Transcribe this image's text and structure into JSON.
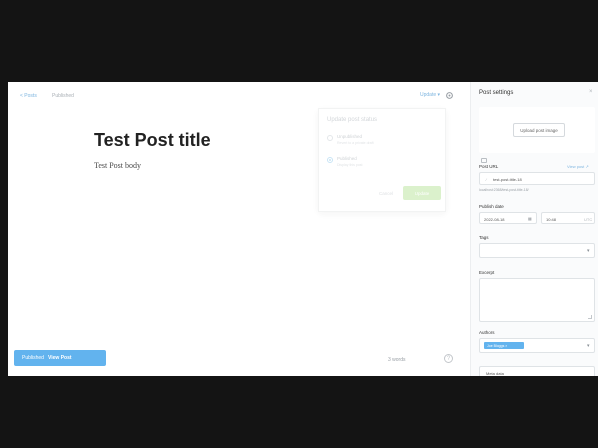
{
  "header": {
    "back_label": "< Posts",
    "status_label": "Published",
    "update_label": "Update ▾"
  },
  "post": {
    "title": "Test Post title",
    "body": "Test Post body"
  },
  "publish_menu": {
    "title": "Update post status",
    "options": [
      {
        "label": "Unpublished",
        "desc": "Revert to a private draft"
      },
      {
        "label": "Published",
        "desc": "Display this post"
      }
    ],
    "cancel_label": "Cancel",
    "action_label": "Update"
  },
  "toast": {
    "text": "Published",
    "link": "View Post"
  },
  "footer": {
    "word_count": "3 words",
    "help_glyph": "?"
  },
  "settings": {
    "title": "Post settings",
    "close_glyph": "×",
    "upload_label": "Upload post image",
    "post_url_label": "Post URL",
    "post_url_link": "View post ↗",
    "post_url_value": "test-post-title-18",
    "post_url_hint": "localhost:2368/test-post-title-18/",
    "publish_date_label": "Publish date",
    "publish_date_value": "2022-08-18",
    "publish_time_value": "10:48",
    "publish_tz": "UTC",
    "tags_label": "Tags",
    "excerpt_label": "Excerpt",
    "authors_label": "Authors",
    "author_chip": "Joe Bloggs ×",
    "meta_data_label": "Meta data"
  },
  "colors": {
    "accent": "#62b3ee",
    "link": "#7fb6e0",
    "letterbox": "#141414"
  }
}
